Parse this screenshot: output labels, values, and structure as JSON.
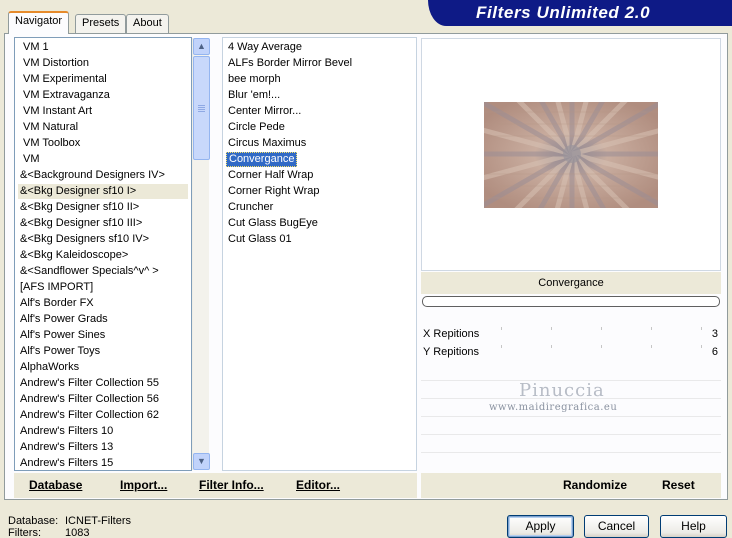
{
  "tabs": [
    {
      "label": "Navigator",
      "active": true
    },
    {
      "label": "Presets",
      "active": false
    },
    {
      "label": "About",
      "active": false
    }
  ],
  "banner_title": "Filters Unlimited 2.0",
  "categories": [
    "VM 1",
    "VM Distortion",
    "VM Experimental",
    "VM Extravaganza",
    "VM Instant Art",
    "VM Natural",
    "VM Toolbox",
    "VM",
    "&<Background Designers IV>",
    "&<Bkg Designer sf10 I>",
    "&<Bkg Designer sf10 II>",
    "&<Bkg Designer sf10 III>",
    "&<Bkg Designers sf10 IV>",
    "&<Bkg Kaleidoscope>",
    "&<Sandflower Specials^v^ >",
    "[AFS IMPORT]",
    "Alf's Border FX",
    "Alf's Power Grads",
    "Alf's Power Sines",
    "Alf's Power Toys",
    "AlphaWorks",
    "Andrew's Filter Collection 55",
    "Andrew's Filter Collection 56",
    "Andrew's Filter Collection 62",
    "Andrew's Filters 10",
    "Andrew's Filters 13",
    "Andrew's Filters 15"
  ],
  "selected_category": "&<Bkg Designer sf10 I>",
  "filters": [
    "4 Way Average",
    "ALFs Border Mirror Bevel",
    "bee morph",
    "Blur 'em!...",
    "Center Mirror...",
    "Circle Pede",
    "Circus Maximus",
    "Convergance",
    "Corner Half Wrap",
    "Corner Right Wrap",
    "Cruncher",
    "Cut Glass  BugEye",
    "Cut Glass 01"
  ],
  "selected_filter": "Convergance",
  "filter_name": "Convergance",
  "params": [
    {
      "label": "X Repitions",
      "value": "3"
    },
    {
      "label": "Y Repitions",
      "value": "6"
    }
  ],
  "watermark": {
    "name": "Pinuccia",
    "url": "www.maidiregrafica.eu"
  },
  "bar_buttons": {
    "database": "Database",
    "import": "Import...",
    "filter_info": "Filter Info...",
    "editor": "Editor...",
    "randomize": "Randomize",
    "reset": "Reset"
  },
  "status": {
    "database_label": "Database:",
    "database_value": "ICNET-Filters",
    "filters_label": "Filters:",
    "filters_value": "1083"
  },
  "dialog_buttons": {
    "apply": "Apply",
    "cancel": "Cancel",
    "help": "Help"
  },
  "colors": {
    "banner": "#0e1a86",
    "selection": "#316ac5",
    "window": "#ece9d8",
    "preview_tone": "#b59b90"
  },
  "icons": {
    "scroll_up": "up-arrow",
    "scroll_down": "down-arrow"
  }
}
